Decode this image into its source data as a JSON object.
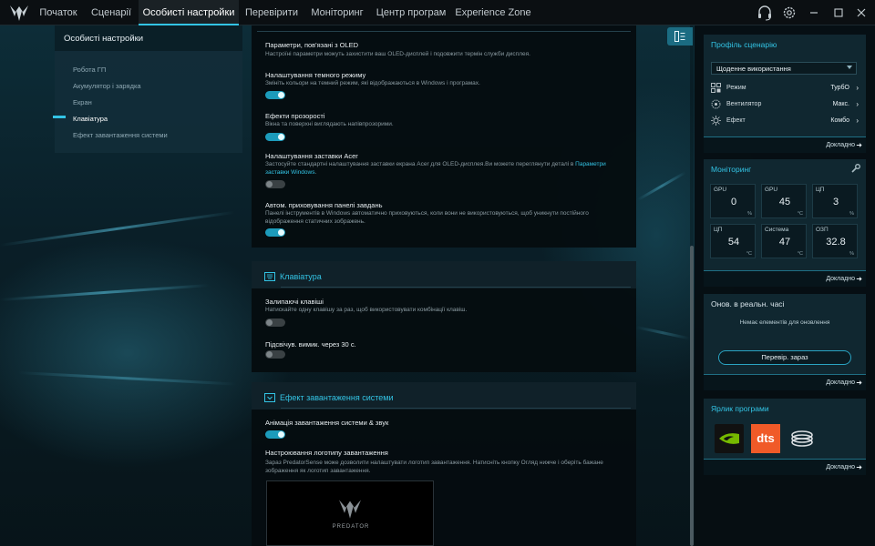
{
  "app": {
    "brand_icon": "predator-logo-icon",
    "accent_color": "#33c4e5"
  },
  "nav": {
    "tabs": [
      {
        "label": "Початок",
        "active": false
      },
      {
        "label": "Сценарії",
        "active": false
      },
      {
        "label": "Особисті настройки",
        "active": true
      },
      {
        "label": "Перевірити",
        "active": false
      },
      {
        "label": "Моніторинг",
        "active": false
      },
      {
        "label": "Центр програм",
        "active": false
      },
      {
        "label": "Experience Zone",
        "active": false
      }
    ],
    "icons": [
      "headset-icon",
      "settings-icon",
      "minimize-icon",
      "maximize-icon",
      "close-icon"
    ]
  },
  "left_panel": {
    "title": "Особисті настройки",
    "items": [
      {
        "label": "Робота ГП",
        "active": false
      },
      {
        "label": "Акумулятор і зарядка",
        "active": false
      },
      {
        "label": "Екран",
        "active": false
      },
      {
        "label": "Клавіатура",
        "active": true
      },
      {
        "label": "Ефект завантаження системи",
        "active": false
      }
    ]
  },
  "screen_settings": {
    "oled": {
      "title": "Параметри, пов'язані з OLED",
      "desc": "Настроїні параметри можуть захистити ваш OLED-дисплей і подовжити термін служби дисплея."
    },
    "dark_mode": {
      "title": "Налаштування темного режиму",
      "desc": "Змініть кольори на темний режим, які відображаються в Windows і програмах.",
      "enabled": true
    },
    "transparency": {
      "title": "Ефекти прозорості",
      "desc": "Вікна та поверхні виглядають напівпрозорими.",
      "enabled": true
    },
    "screensaver": {
      "title": "Налаштування заставки Acer",
      "desc": "Застосуйте стандартні налаштування заставки екрана Acer для OLED-дисплея.Ви можете переглянути деталі в",
      "link": "Параметри заставки Windows",
      "after_link": ".",
      "enabled": false
    },
    "autohide_taskbar": {
      "title": "Автом. приховування панелі завдань",
      "desc": "Панелі інструментів в Windows автоматично приховуються, коли вони не використовуються, щоб уникнути постійного відображення статичних зображень.",
      "enabled": true
    }
  },
  "keyboard": {
    "header": "Клавіатура",
    "icon": "keyboard-icon",
    "sticky_keys": {
      "title": "Залипаючі клавіші",
      "desc": "Натискайте одну клавішу за раз, щоб використовувати комбінації клавіш.",
      "enabled": false
    },
    "backlight_off": {
      "title": "Підсвічув. вимик. через 30 с.",
      "enabled": false
    }
  },
  "boot_effect": {
    "header": "Ефект завантаження системи",
    "icon": "boot-effect-icon",
    "animation": {
      "title": "Анімація завантаження системи & звук",
      "enabled": true
    },
    "logo": {
      "title": "Настроювання логотипу завантаження",
      "desc": "Зараз PredatorSense може дозволити налаштувати логотип завантаження. Натисніть кнопку Огляд нижче і оберіть бажане зображення як логотип завантаження.",
      "preview_text": "PREDATOR"
    }
  },
  "right": {
    "toggle_icon": "panel-toggle-icon",
    "profile": {
      "title": "Профіль сценарію",
      "selected": "Щоденне використання",
      "rows": [
        {
          "icon": "mode-icon",
          "label": "Режим",
          "value": "ТурбО"
        },
        {
          "icon": "fan-icon",
          "label": "Вентилятор",
          "value": "Макс."
        },
        {
          "icon": "effect-icon",
          "label": "Ефект",
          "value": "Комбо"
        }
      ],
      "more": "Докладно"
    },
    "monitoring": {
      "title": "Моніторинг",
      "tool_icon": "wrench-icon",
      "tiles": [
        {
          "label": "GPU",
          "value": "0",
          "unit": "%"
        },
        {
          "label": "GPU",
          "value": "45",
          "unit": "°C"
        },
        {
          "label": "ЦП",
          "value": "3",
          "unit": "%"
        },
        {
          "label": "ЦП",
          "value": "54",
          "unit": "°C"
        },
        {
          "label": "Система",
          "value": "47",
          "unit": "°C"
        },
        {
          "label": "ОЗП",
          "value": "32.8",
          "unit": "%"
        }
      ],
      "more": "Докладно"
    },
    "updates": {
      "title": "Онов. в реальн. часі",
      "empty": "Немає елементів для оновлення",
      "button": "Перевір. зараз",
      "more": "Докладно"
    },
    "shortcuts": {
      "title": "Ярлик програми",
      "apps": [
        "nvidia-icon",
        "dts-icon",
        "app-launcher-icon"
      ],
      "dts_label": "dts",
      "more": "Докладно"
    }
  }
}
